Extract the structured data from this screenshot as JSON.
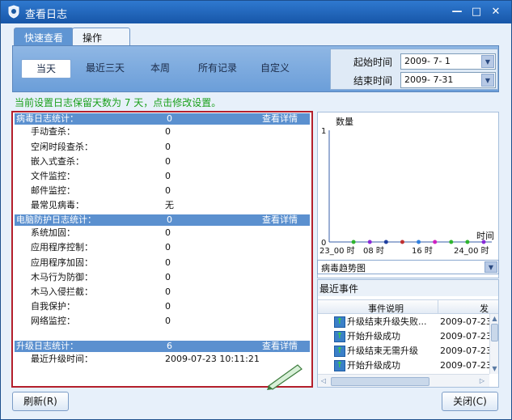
{
  "window": {
    "title": "查看日志",
    "min_label": "—",
    "max_label": "□",
    "close_label": "✕"
  },
  "tabs": [
    {
      "label": "快速查看"
    },
    {
      "label": "操作"
    }
  ],
  "quick": {
    "today": "当天",
    "last3": "最近三天",
    "week": "本周",
    "all": "所有记录",
    "custom": "自定义"
  },
  "dates": {
    "start_label": "起始时间",
    "start_value": "2009- 7- 1",
    "end_label": "结束时间",
    "end_value": "2009- 7-31"
  },
  "notice": "当前设置日志保留天数为 7 天，点击修改设置。",
  "virus": {
    "header": "病毒日志统计：",
    "value": "0",
    "detail": "查看详情",
    "rows": [
      {
        "label": "手动查杀：",
        "value": "0"
      },
      {
        "label": "空闲时段查杀：",
        "value": "0"
      },
      {
        "label": "嵌入式查杀：",
        "value": "0"
      },
      {
        "label": "文件监控：",
        "value": "0"
      },
      {
        "label": "邮件监控：",
        "value": "0"
      },
      {
        "label": "最常见病毒：",
        "value": "无"
      }
    ]
  },
  "protect": {
    "header": "电脑防护日志统计：",
    "value": "0",
    "detail": "查看详情",
    "rows": [
      {
        "label": "系统加固：",
        "value": "0"
      },
      {
        "label": "应用程序控制：",
        "value": "0"
      },
      {
        "label": "应用程序加固：",
        "value": "0"
      },
      {
        "label": "木马行为防御：",
        "value": "0"
      },
      {
        "label": "木马入侵拦截：",
        "value": "0"
      },
      {
        "label": "自我保护：",
        "value": "0"
      },
      {
        "label": "网络监控：",
        "value": "0"
      }
    ]
  },
  "upgrade": {
    "header": "升级日志统计：",
    "value": "6",
    "detail": "查看详情",
    "rows": [
      {
        "label": "最近升级时间：",
        "value": "2009-07-23 10:11:21"
      }
    ]
  },
  "trend": {
    "ylabel": "数量",
    "xlabel": "时间",
    "selected": "病毒趋势图",
    "yticks": [
      "1",
      "0"
    ],
    "xticks": [
      "23_00 时",
      "08 时",
      "16 时",
      "24_00 时"
    ],
    "point_colors": [
      "#2fb52f",
      "#8a2bd8",
      "#1f3fa0",
      "#c03030",
      "#3080e0",
      "#d020c0",
      "#2fb52f"
    ]
  },
  "chart_data": {
    "type": "line",
    "title": "",
    "xlabel": "时间",
    "ylabel": "数量",
    "ylim": [
      0,
      1
    ],
    "x": [
      "23_00",
      "",
      "",
      "08",
      "",
      "",
      "16",
      "",
      "",
      "24_00"
    ],
    "series": [
      {
        "values": [
          0,
          0,
          0,
          0,
          0,
          0,
          0,
          0,
          0,
          0
        ]
      }
    ]
  },
  "events": {
    "title": "最近事件",
    "col_desc": "事件说明",
    "col_time": "发",
    "rows": [
      {
        "desc": "升级结束升级失败...",
        "time": "2009-07-23"
      },
      {
        "desc": "开始升级成功",
        "time": "2009-07-23"
      },
      {
        "desc": "升级结束无需升级",
        "time": "2009-07-23"
      },
      {
        "desc": "开始升级成功",
        "time": "2009-07-23"
      }
    ]
  },
  "buttons": {
    "refresh": "刷新(R)",
    "close": "关闭(C)"
  }
}
